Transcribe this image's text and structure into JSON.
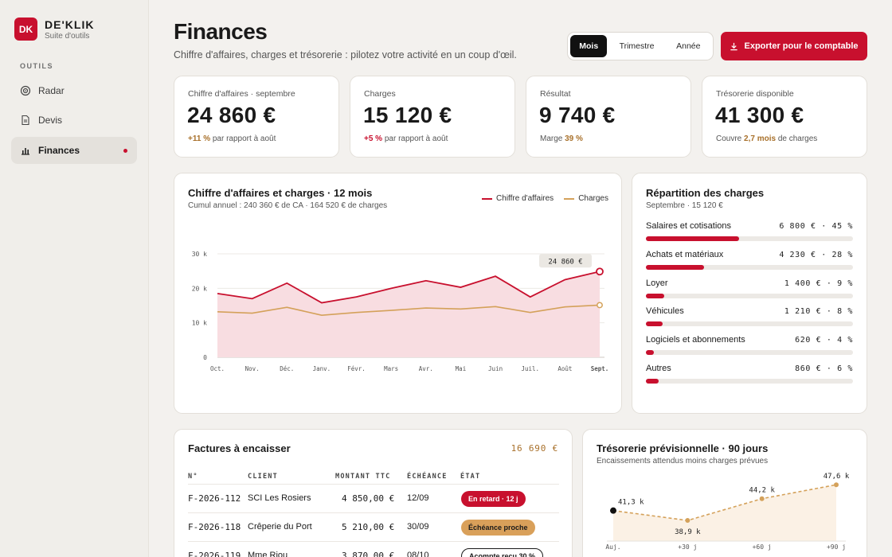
{
  "brand": {
    "logo": "DK",
    "name": "DE'KLIK",
    "sub": "Suite d'outils"
  },
  "nav": {
    "section": "OUTILS",
    "items": [
      {
        "label": "Radar",
        "icon": "target-icon"
      },
      {
        "label": "Devis",
        "icon": "document-icon"
      },
      {
        "label": "Finances",
        "icon": "bar-chart-icon"
      }
    ]
  },
  "header": {
    "title": "Finances",
    "subtitle": "Chiffre d'affaires, charges et trésorerie : pilotez votre activité en un coup d'œil.",
    "periods": [
      "Mois",
      "Trimestre",
      "Année"
    ],
    "active_period": "Mois",
    "export_label": "Exporter pour le comptable"
  },
  "kpis": [
    {
      "label": "Chiffre d'affaires · septembre",
      "value": "24 860 €",
      "foot_highlight": "+11 %",
      "foot_text": " par rapport à août"
    },
    {
      "label": "Charges",
      "value": "15 120 €",
      "foot_highlight": "+5 %",
      "foot_text": " par rapport à août"
    },
    {
      "label": "Résultat",
      "value": "9 740 €",
      "foot_pre": "Marge ",
      "foot_highlight": "39 %"
    },
    {
      "label": "Trésorerie disponible",
      "value": "41 300 €",
      "foot_pre": "Couvre ",
      "foot_highlight": "2,7 mois",
      "foot_text": " de charges"
    }
  ],
  "trend": {
    "title": "Chiffre d'affaires et charges · 12 mois",
    "subtitle": "Cumul annuel : 240 360 € de CA · 164 520 € de charges",
    "last_label": "24 860 €"
  },
  "chart_data": {
    "type": "area",
    "categories": [
      "Oct.",
      "Nov.",
      "Déc.",
      "Janv.",
      "Févr.",
      "Mars",
      "Avr.",
      "Mai",
      "Juin",
      "Juil.",
      "Août",
      "Sept."
    ],
    "series": [
      {
        "name": "Chiffre d'affaires",
        "values": [
          18.5,
          17.0,
          21.5,
          15.8,
          17.5,
          20.0,
          22.2,
          20.3,
          23.5,
          17.5,
          22.5,
          24.86
        ]
      },
      {
        "name": "Charges",
        "values": [
          13.2,
          12.8,
          14.5,
          12.2,
          13.0,
          13.6,
          14.3,
          14.0,
          14.7,
          13.0,
          14.6,
          15.12
        ]
      }
    ],
    "yticks": [
      "0",
      "10 k",
      "20 k",
      "30 k"
    ],
    "ylim": [
      0,
      30
    ],
    "grid": true,
    "legend": "top-right",
    "colors": {
      "revenue": "#c8102e",
      "charges": "#d4a15a",
      "area": "#f8dde1"
    }
  },
  "breakdown": {
    "title": "Répartition des charges",
    "subtitle": "Septembre · 15 120 €",
    "items": [
      {
        "label": "Salaires et cotisations",
        "value": "6 800 € · 45 %",
        "pct": 45
      },
      {
        "label": "Achats et matériaux",
        "value": "4 230 € · 28 %",
        "pct": 28
      },
      {
        "label": "Loyer",
        "value": "1 400 € · 9 %",
        "pct": 9
      },
      {
        "label": "Véhicules",
        "value": "1 210 € · 8 %",
        "pct": 8
      },
      {
        "label": "Logiciels et abonnements",
        "value": "620 € · 4 %",
        "pct": 4
      },
      {
        "label": "Autres",
        "value": "860 € · 6 %",
        "pct": 6
      }
    ]
  },
  "invoices": {
    "title": "Factures à encaisser",
    "total": "16 690 €",
    "columns": [
      "N°",
      "CLIENT",
      "MONTANT TTC",
      "ÉCHÉANCE",
      "ÉTAT"
    ],
    "rows": [
      {
        "num": "F-2026-112",
        "client": "SCI Les Rosiers",
        "amount": "4 850,00 €",
        "due": "12/09",
        "status": "En retard · 12 j",
        "status_kind": "late"
      },
      {
        "num": "F-2026-118",
        "client": "Crêperie du Port",
        "amount": "5 210,00 €",
        "due": "30/09",
        "status": "Échéance proche",
        "status_kind": "soon"
      },
      {
        "num": "F-2026-119",
        "client": "Mme Riou",
        "amount": "3 870,00 €",
        "due": "08/10",
        "status": "Acompte reçu 30 %",
        "status_kind": "deposit"
      }
    ]
  },
  "forecast": {
    "title": "Trésorerie prévisionnelle · 90 jours",
    "subtitle": "Encaissements attendus moins charges prévues",
    "points": [
      {
        "x": "Auj.",
        "value": 41.3,
        "label": "41,3 k"
      },
      {
        "x": "+30 j",
        "value": 38.9,
        "label": "38,9 k"
      },
      {
        "x": "+60 j",
        "value": 44.2,
        "label": "44,2 k"
      },
      {
        "x": "+90 j",
        "value": 47.6,
        "label": "47,6 k"
      }
    ]
  }
}
